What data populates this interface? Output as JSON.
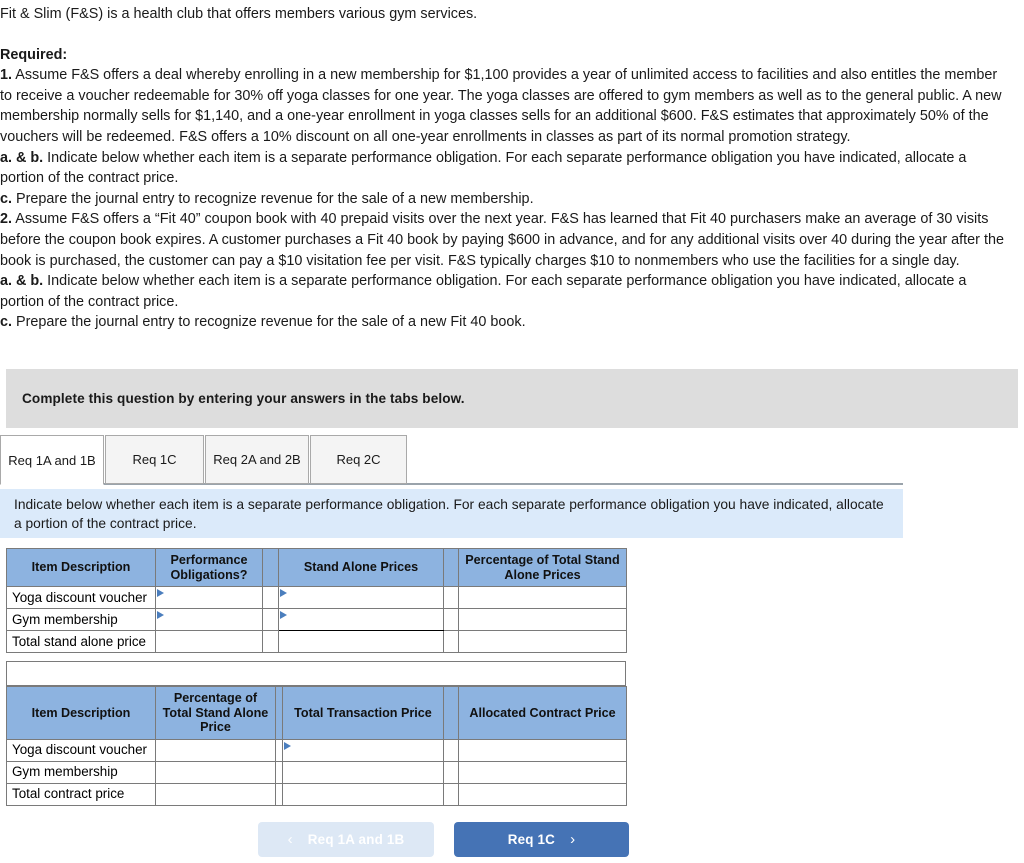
{
  "problem": {
    "intro": "Fit & Slim (F&S) is a health club that offers members various gym services.",
    "required_label": "Required:",
    "q1_num": "1.",
    "q1_text": " Assume F&S offers a deal whereby enrolling in a new membership for $1,100 provides a year of unlimited access to facilities and also entitles the member to receive a voucher redeemable for 30% off yoga classes for one year. The yoga classes are offered to gym members as well as to the general public. A new membership normally sells for $1,140, and a one-year enrollment in yoga classes sells for an additional $600. F&S estimates that approximately 50% of the vouchers will be redeemed. F&S offers a 10% discount on all one-year enrollments in classes as part of its normal promotion strategy.",
    "q1ab_num": "a. & b.",
    "q1ab_text": " Indicate below whether each item is a separate performance obligation. For each separate performance obligation you have indicated, allocate a portion of the contract price.",
    "q1c_num": "c.",
    "q1c_text": " Prepare the journal entry to recognize revenue for the sale of a new membership.",
    "q2_num": "2.",
    "q2_text": " Assume F&S offers a “Fit 40” coupon book with 40 prepaid visits over the next year. F&S has learned that Fit 40 purchasers make an average of 30 visits before the coupon book expires. A customer purchases a Fit 40 book by paying $600 in advance, and for any additional visits over 40 during the year after the book is purchased, the customer can pay a $10 visitation fee per visit. F&S typically charges $10 to nonmembers who use the facilities for a single day.",
    "q2ab_num": "a. & b.",
    "q2ab_text": " Indicate below whether each item is a separate performance obligation. For each separate performance obligation you have indicated, allocate a portion of the contract price.",
    "q2c_num": "c.",
    "q2c_text": " Prepare the journal entry to recognize revenue for the sale of a new Fit 40 book."
  },
  "banner": {
    "text": "Complete this question by entering your answers in the tabs below."
  },
  "tabs": [
    {
      "label": "Req 1A and 1B",
      "active": true
    },
    {
      "label": "Req 1C",
      "active": false
    },
    {
      "label": "Req 2A and 2B",
      "active": false
    },
    {
      "label": "Req 2C",
      "active": false
    }
  ],
  "instruction": {
    "text": "Indicate below whether each item is a separate performance obligation. For each separate performance obligation you have indicated, allocate a portion of the contract price."
  },
  "table1": {
    "headers": [
      "Item Description",
      "Performance Obligations?",
      "Stand Alone Prices",
      "Percentage of Total Stand Alone Prices"
    ],
    "rows": [
      {
        "label": "Yoga discount voucher",
        "obligation": "",
        "stand_alone": "",
        "percentage": ""
      },
      {
        "label": "Gym membership",
        "obligation": "",
        "stand_alone": "",
        "percentage": ""
      },
      {
        "label": "Total stand alone price",
        "obligation": "",
        "stand_alone": "",
        "percentage": ""
      }
    ]
  },
  "table2": {
    "headers": [
      "Item Description",
      "Percentage of Total Stand Alone Price",
      "Total Transaction Price",
      "Allocated Contract Price"
    ],
    "rows": [
      {
        "label": "Yoga discount voucher",
        "percentage": "",
        "transaction": "",
        "allocated": ""
      },
      {
        "label": "Gym membership",
        "percentage": "",
        "transaction": "",
        "allocated": ""
      },
      {
        "label": "Total contract price",
        "percentage": "",
        "transaction": "",
        "allocated": ""
      }
    ]
  },
  "nav": {
    "prev_label": "Req 1A and 1B",
    "next_label": "Req 1C",
    "prev_icon": "chevron-left-icon",
    "next_icon": "chevron-right-icon"
  },
  "colors": {
    "header_blue": "#8db3e0",
    "instruction_blue": "#dbeafa",
    "banner_grey": "#dddddd",
    "next_button_blue": "#4573b5",
    "prev_button_blue": "#dde8f5",
    "caret_blue": "#4b7ebd"
  }
}
